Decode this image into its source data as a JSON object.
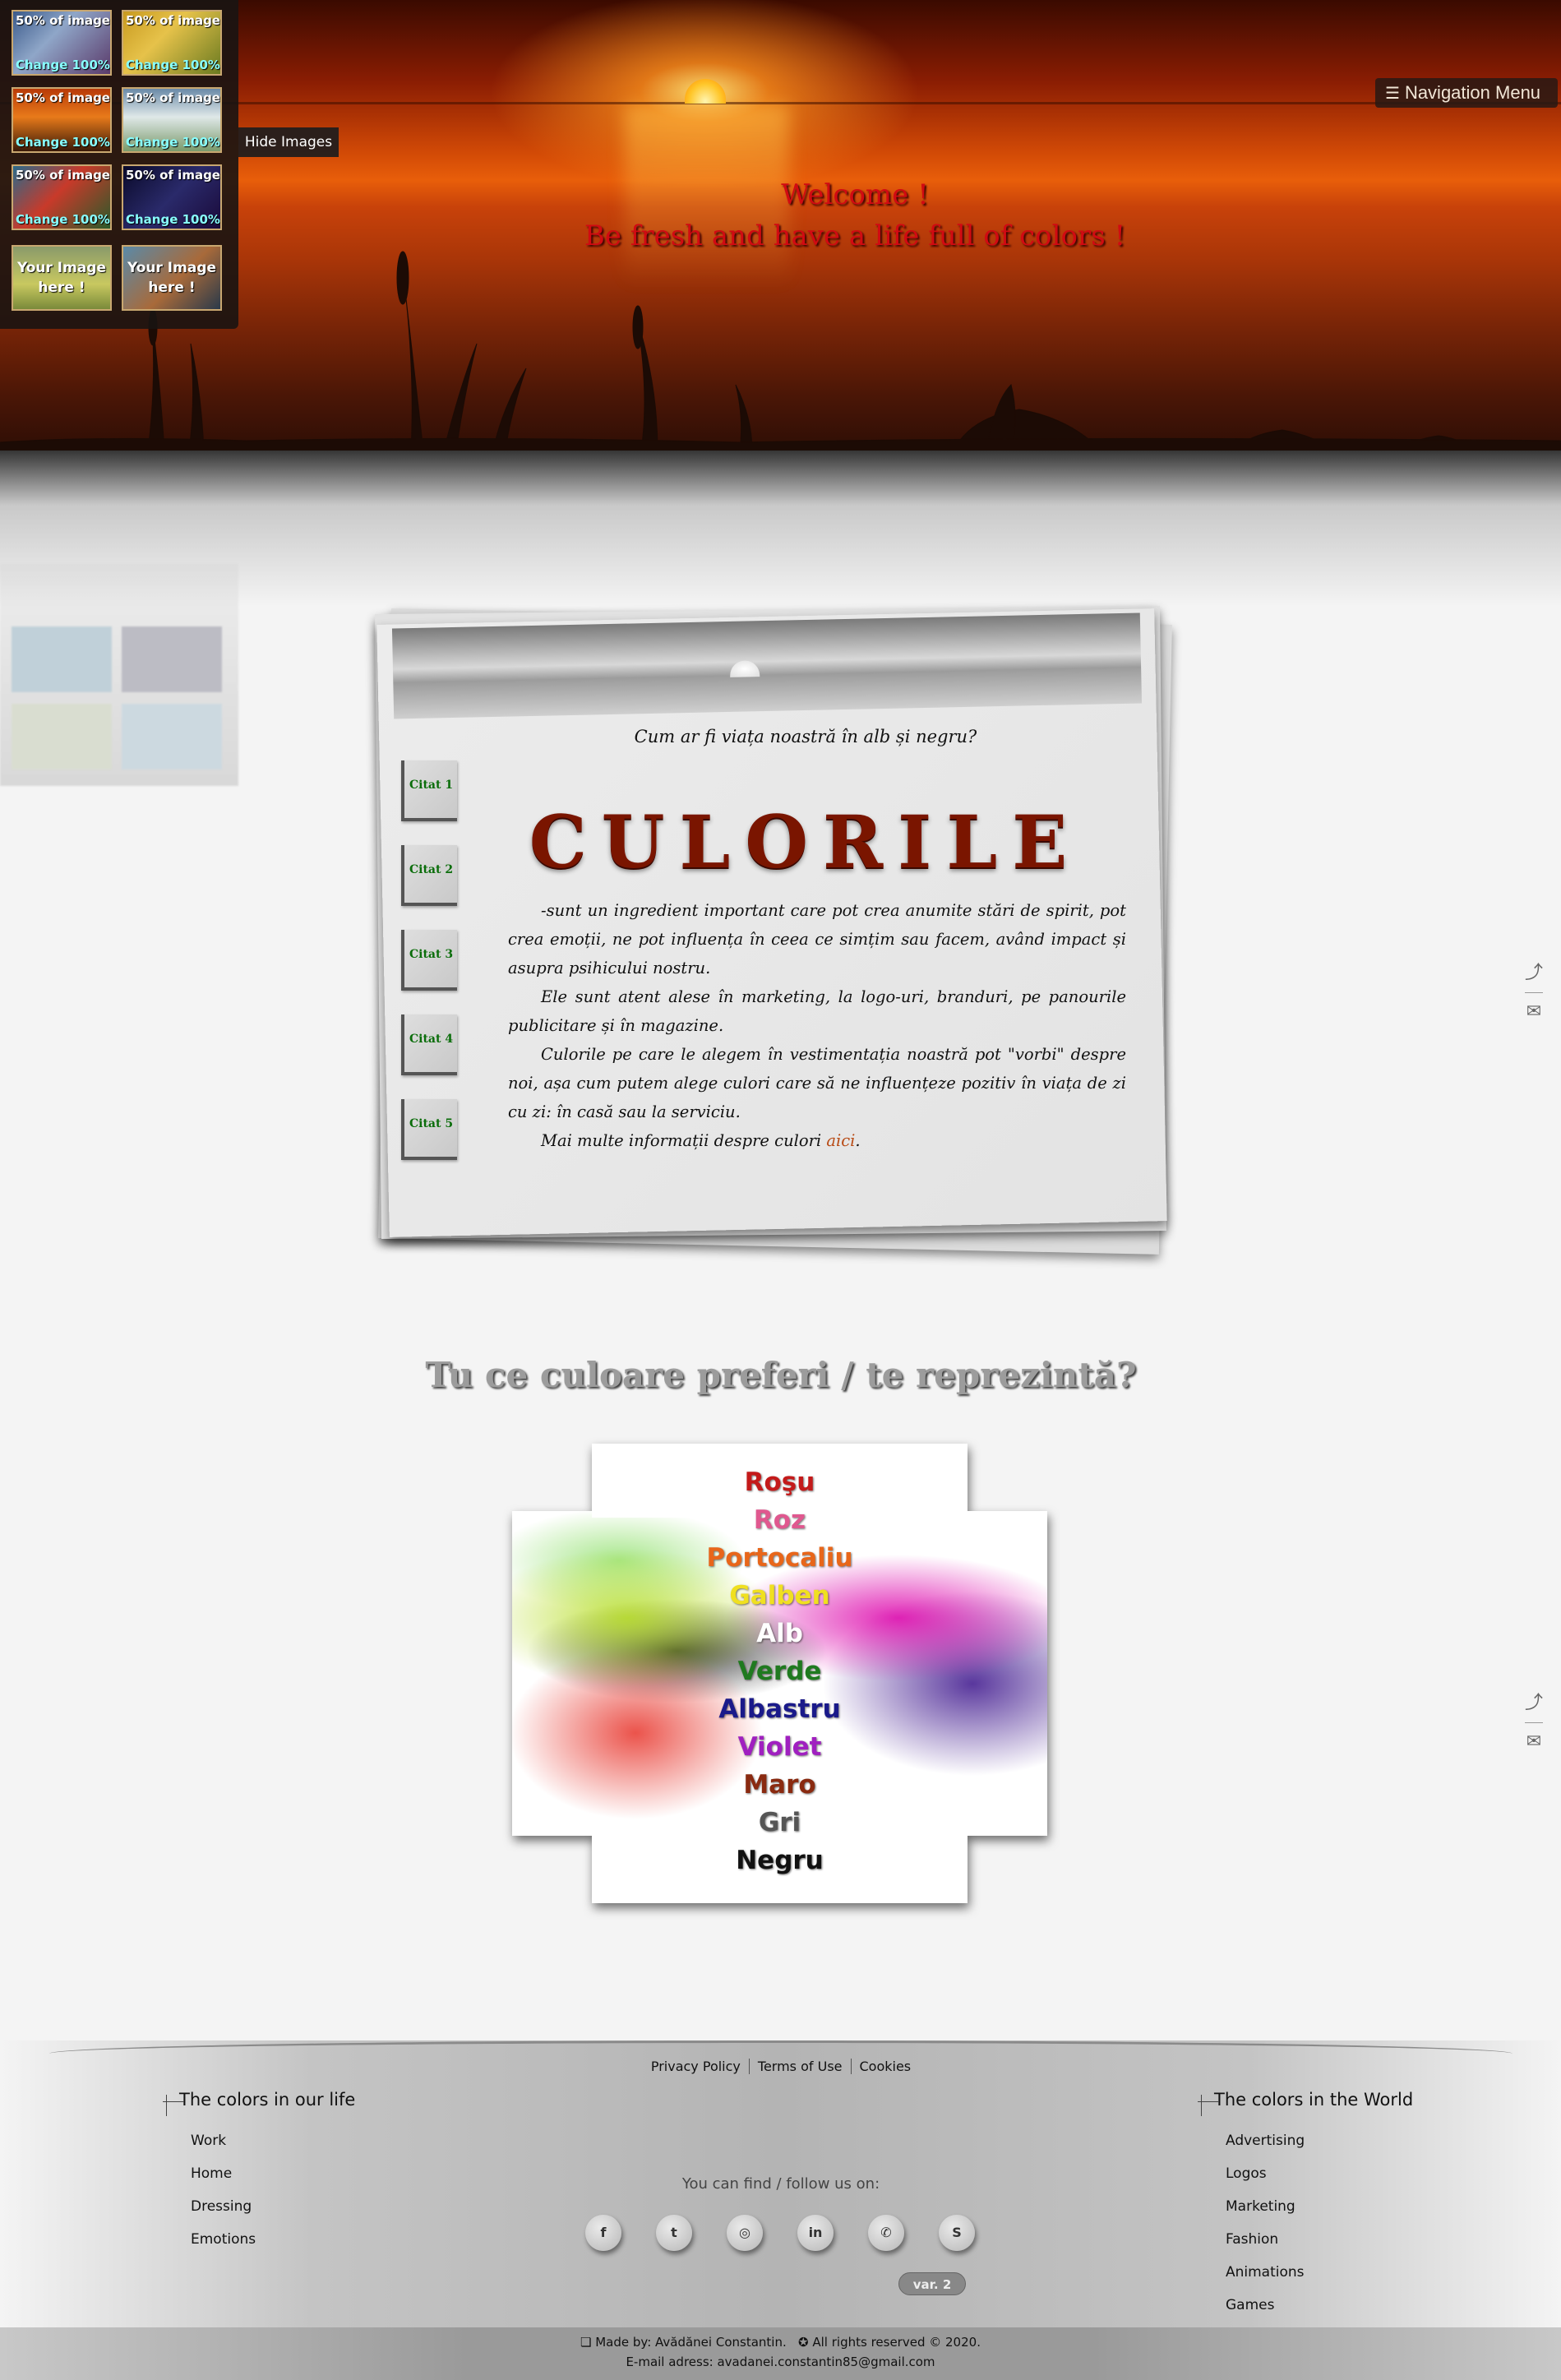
{
  "hero": {
    "welcome_line1": "Welcome !",
    "welcome_line2": "Be fresh and have a life full of colors !"
  },
  "nav": {
    "label": "Navigation Menu",
    "icon": "hamburger-icon"
  },
  "image_panel": {
    "thumbs": [
      {
        "top": "50% of image",
        "bottom": "Change 100%"
      },
      {
        "top": "50% of image",
        "bottom": "Change 100%"
      },
      {
        "top": "50% of image",
        "bottom": "Change 100%"
      },
      {
        "top": "50% of image",
        "bottom": "Change 100%"
      },
      {
        "top": "50% of image",
        "bottom": "Change 100%"
      },
      {
        "top": "50% of image",
        "bottom": "Change 100%"
      },
      {
        "middle": "Your Image here !"
      },
      {
        "middle": "Your Image here !"
      }
    ],
    "hide_label": "Hide Images"
  },
  "card": {
    "question": "Cum ar fi viața noastră în alb și negru?",
    "title": "CULORILE",
    "citate": [
      "Citat 1",
      "Citat 2",
      "Citat 3",
      "Citat 4",
      "Citat 5"
    ],
    "p1": "-sunt un ingredient important care pot crea anumite stări de spirit, pot crea emoții, ne pot influența în ceea ce simțim sau facem, având impact și asupra psihicului nostru.",
    "p2": "Ele sunt atent alese în marketing, la logo-uri, branduri, pe panourile publicitare și în magazine.",
    "p3": "Culorile pe care le alegem în vestimentația noastră pot \"vorbi\" despre noi, așa cum putem alege culori care să ne influențeze pozitiv în viața de zi cu zi: în casă sau la serviciu.",
    "p4_prefix": "Mai multe informații despre culori",
    "p4_link": "aici",
    "p4_suffix": "."
  },
  "colors_section": {
    "title": "Tu ce culoare preferi / te reprezintă?",
    "items": [
      {
        "label": "Roşu",
        "color": "#c41a1a"
      },
      {
        "label": "Roz",
        "color": "#e0588f"
      },
      {
        "label": "Portocaliu",
        "color": "#e8661a"
      },
      {
        "label": "Galben",
        "color": "#f0e020"
      },
      {
        "label": "Alb",
        "color": "#ffffff"
      },
      {
        "label": "Verde",
        "color": "#1f7a1f"
      },
      {
        "label": "Albastru",
        "color": "#1a1a8a"
      },
      {
        "label": "Violet",
        "color": "#a020c0"
      },
      {
        "label": "Maro",
        "color": "#8a2a10"
      },
      {
        "label": "Gri",
        "color": "#555555"
      },
      {
        "label": "Negru",
        "color": "#111111"
      }
    ]
  },
  "side_icons": [
    "share-icon",
    "mail-icon"
  ],
  "footer": {
    "legal": [
      "Privacy Policy",
      "Terms of Use",
      "Cookies"
    ],
    "left_title": "The colors in our life",
    "left_items": [
      "Work",
      "Home",
      "Dressing",
      "Emotions"
    ],
    "right_title": "The colors in the World",
    "right_items": [
      "Advertising",
      "Logos",
      "Marketing",
      "Fashion",
      "Animations",
      "Games"
    ],
    "follow": "You can find / follow us on:",
    "socials": [
      {
        "icon": "facebook-icon",
        "glyph": "f"
      },
      {
        "icon": "twitter-icon",
        "glyph": "t"
      },
      {
        "icon": "instagram-icon",
        "glyph": "◎"
      },
      {
        "icon": "linkedin-icon",
        "glyph": "in"
      },
      {
        "icon": "whatsapp-icon",
        "glyph": "✆"
      },
      {
        "icon": "skype-icon",
        "glyph": "S"
      }
    ],
    "version": "var. 2",
    "made_by": "❏ Made by: Avădănei Constantin.",
    "rights": "✪ All rights reserved © 2020.",
    "email": "E-mail adress: avadanei.constantin85@gmail.com"
  }
}
